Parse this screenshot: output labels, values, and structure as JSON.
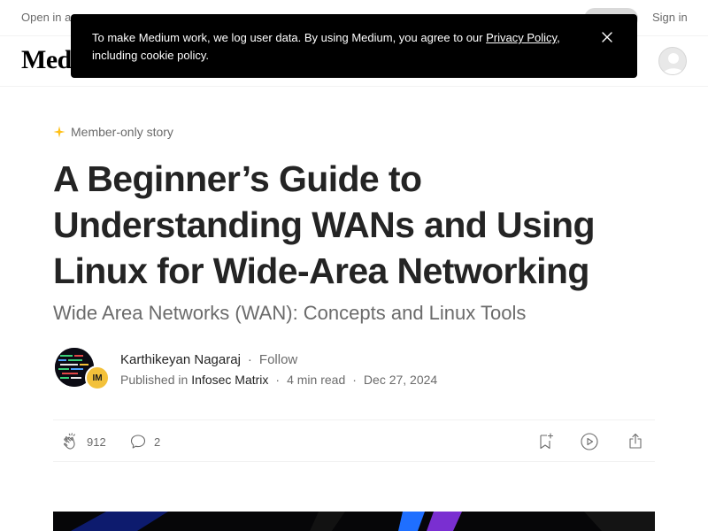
{
  "topbar": {
    "open_in_app": "Open in app",
    "sign_in": "Sign in"
  },
  "header": {
    "logo": "Medium"
  },
  "cookie_banner": {
    "text_before_link": "To make Medium work, we log user data. By using Medium, you agree to our ",
    "link_text": "Privacy Policy",
    "text_after_link": ", including cookie policy."
  },
  "article": {
    "member_badge": "Member-only story",
    "title": "A Beginner’s Guide to Understanding WANs and Using Linux for Wide-Area Networking",
    "subtitle": "Wide Area Networks (WAN): Concepts and Linux Tools",
    "author": "Karthikeyan Nagaraj",
    "follow": "Follow",
    "published_in_label": "Published in",
    "publication": "Infosec Matrix",
    "publication_badge": "IM",
    "read_time": "4 min read",
    "date": "Dec 27, 2024",
    "separator": "·"
  },
  "actions": {
    "claps": "912",
    "responses": "2"
  },
  "colors": {
    "text_primary": "#242424",
    "text_secondary": "#6b6b6b",
    "member_star": "#ffc017",
    "banner_bg": "#000000",
    "publication_badge": "#f3c13a"
  },
  "icons": [
    "member-star-icon",
    "close-icon",
    "user-avatar-icon",
    "clap-icon",
    "response-icon",
    "bookmark-icon",
    "listen-icon",
    "share-icon"
  ]
}
